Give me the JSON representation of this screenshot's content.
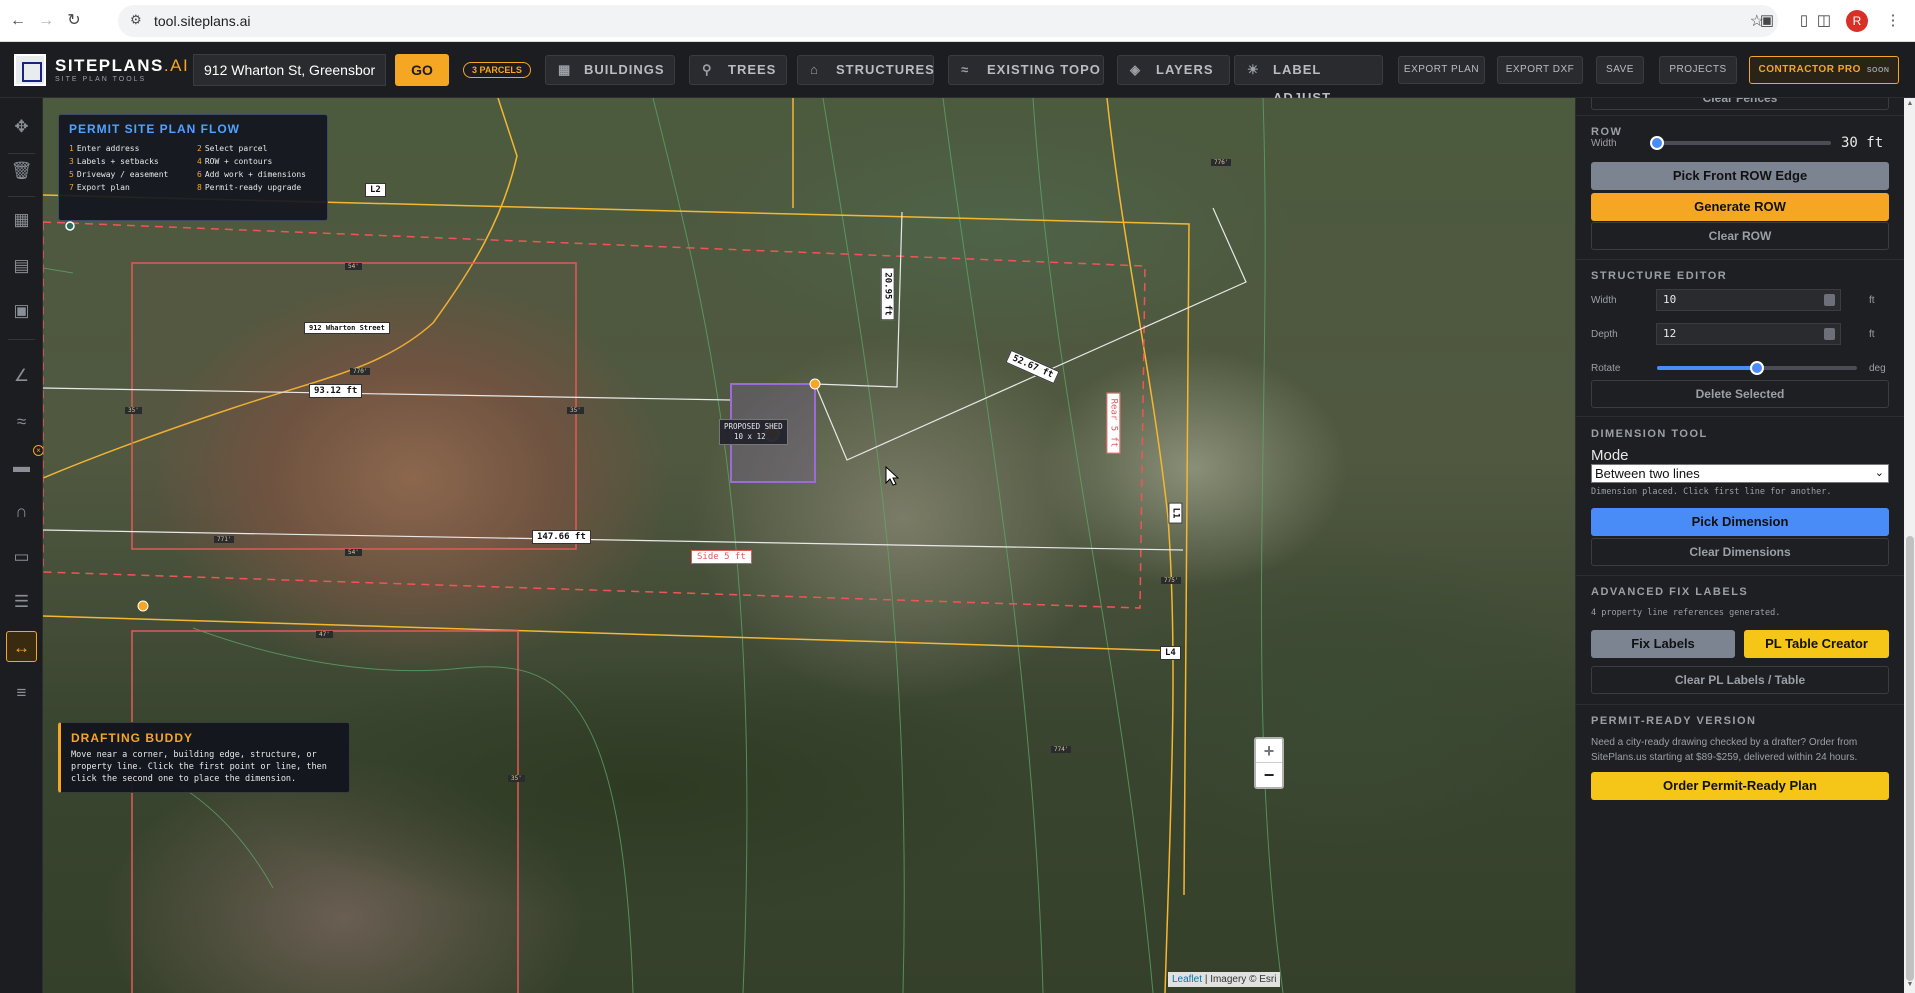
{
  "browser": {
    "url": "tool.siteplans.ai",
    "avatar_initial": "R"
  },
  "header": {
    "logo_main": "SITEPLANS",
    "logo_ai": ".AI",
    "logo_sub": "SITE PLAN TOOLS",
    "address_value": "912 Wharton St, Greensbor",
    "go_label": "GO",
    "parcels_badge": "3 PARCELS",
    "buildings_label": "BUILDINGS",
    "trees_label": "TREES",
    "structures_label": "STRUCTURES",
    "topo_label": "EXISTING TOPO",
    "layers_label": "LAYERS",
    "label_adjust_label": "LABEL ADJUST",
    "export_plan_label": "EXPORT PLAN",
    "export_dxf_label": "EXPORT DXF",
    "save_label": "SAVE",
    "projects_label": "PROJECTS",
    "contractor_label": "CONTRACTOR PRO",
    "contractor_soon": "SOON"
  },
  "flow": {
    "title": "PERMIT SITE PLAN FLOW",
    "steps": [
      {
        "n": "1",
        "text": "Enter address"
      },
      {
        "n": "2",
        "text": "Select parcel"
      },
      {
        "n": "3",
        "text": "Labels + setbacks"
      },
      {
        "n": "4",
        "text": "ROW + contours"
      },
      {
        "n": "5",
        "text": "Driveway / easement"
      },
      {
        "n": "6",
        "text": "Add work + dimensions"
      },
      {
        "n": "7",
        "text": "Export plan"
      },
      {
        "n": "8",
        "text": "Permit-ready upgrade"
      }
    ]
  },
  "map": {
    "street_label": "912 Wharton Street",
    "dim_93": "93.12 ft",
    "dim_147": "147.66 ft",
    "dim_5267": "52.67 ft",
    "dim_2095": "20.95 ft",
    "side_setback": "Side 5 ft",
    "rear_setback": "Rear 5 ft",
    "shed_title": "PROPOSED SHED",
    "shed_size": "10 x 12",
    "pl_l1": "L1",
    "pl_l2": "L2",
    "pl_l4": "L4",
    "contours": [
      "54'",
      "35'",
      "35'",
      "770'",
      "771'",
      "54'",
      "47'",
      "35'",
      "775'",
      "776'",
      "774'"
    ],
    "zoom_in": "+",
    "zoom_out": "−",
    "attr_leaflet": "Leaflet",
    "attr_rest": "| Imagery © Esri"
  },
  "buddy": {
    "title": "DRAFTING BUDDY",
    "text": "Move near a corner, building edge, structure, or property line. Click the first point or line, then click the second one to place the dimension."
  },
  "panel": {
    "clear_fences": "Clear Fences",
    "row_title": "ROW",
    "row_width_label": "Width",
    "row_width_value": "30 ft",
    "row_width_fraction": 0.0,
    "pick_front_row": "Pick Front ROW Edge",
    "generate_row": "Generate ROW",
    "clear_row": "Clear ROW",
    "struct_title": "STRUCTURE EDITOR",
    "width_label": "Width",
    "width_value": "10",
    "width_unit": "ft",
    "depth_label": "Depth",
    "depth_value": "12",
    "depth_unit": "ft",
    "rotate_label": "Rotate",
    "rotate_unit": "deg",
    "rotate_fraction": 0.5,
    "delete_selected": "Delete Selected",
    "dim_title": "DIMENSION TOOL",
    "mode_label": "Mode",
    "mode_value": "Between two lines",
    "dim_note": "Dimension placed. Click first line for another.",
    "pick_dimension": "Pick Dimension",
    "clear_dimensions": "Clear Dimensions",
    "fix_title": "ADVANCED FIX LABELS",
    "fix_note": "4 property line references generated.",
    "fix_labels": "Fix Labels",
    "pl_table": "PL Table Creator",
    "clear_pl": "Clear PL Labels / Table",
    "permit_title": "PERMIT-READY VERSION",
    "permit_desc": "Need a city-ready drawing checked by a drafter? Order from SitePlans.us starting at $89-$259, delivered within 24 hours.",
    "order_btn": "Order Permit-Ready Plan"
  },
  "colors": {
    "accent": "#f5a623",
    "blue": "#4a8cf7",
    "setback_red": "#e05a5a",
    "parcel_line": "#f5b731"
  }
}
